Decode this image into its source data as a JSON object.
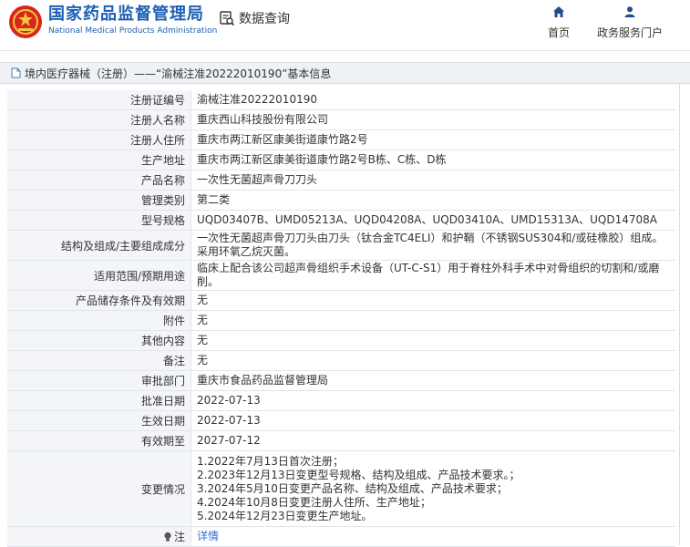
{
  "header": {
    "brand_cn": "国家药品监督管理局",
    "brand_en": "National Medical Products Administration",
    "data_query": "数据查询",
    "nav": [
      {
        "label": "首页",
        "icon": "home-icon"
      },
      {
        "label": "政务服务门户",
        "icon": "user-icon"
      }
    ],
    "colors": {
      "brand": "#1d5fb4",
      "accent": "#2a6fd6"
    }
  },
  "breadcrumb": {
    "text": "境内医疗器械（注册）——“渝械注准20222010190”基本信息"
  },
  "record": {
    "rows": [
      {
        "k": "注册证编号",
        "v": "渝械注准20222010190"
      },
      {
        "k": "注册人名称",
        "v": "重庆西山科技股份有限公司"
      },
      {
        "k": "注册人住所",
        "v": "重庆市两江新区康美街道康竹路2号"
      },
      {
        "k": "生产地址",
        "v": "重庆市两江新区康美街道康竹路2号B栋、C栋、D栋"
      },
      {
        "k": "产品名称",
        "v": "一次性无菌超声骨刀刀头"
      },
      {
        "k": "管理类别",
        "v": "第二类"
      },
      {
        "k": "型号规格",
        "v": "UQD03407B、UMD05213A、UQD04208A、UQD03410A、UMD15313A、UQD14708A"
      },
      {
        "k": "结构及组成/主要组成成分",
        "v": "一次性无菌超声骨刀刀头由刀头（钛合金TC4ELI）和护鞘（不锈钢SUS304和/或硅橡胶）组成。采用环氧乙烷灭菌。"
      },
      {
        "k": "适用范围/预期用途",
        "v": "临床上配合该公司超声骨组织手术设备（UT-C-S1）用于脊柱外科手术中对骨组织的切割和/或磨削。"
      },
      {
        "k": "产品储存条件及有效期",
        "v": "无"
      },
      {
        "k": "附件",
        "v": "无"
      },
      {
        "k": "其他内容",
        "v": "无"
      },
      {
        "k": "备注",
        "v": "无"
      },
      {
        "k": "审批部门",
        "v": "重庆市食品药品监督管理局"
      },
      {
        "k": "批准日期",
        "v": "2022-07-13"
      },
      {
        "k": "生效日期",
        "v": "2022-07-13"
      },
      {
        "k": "有效期至",
        "v": "2027-07-12"
      }
    ],
    "changes_label": "变更情况",
    "changes": [
      "1.2022年7月13日首次注册；",
      "2.2023年12月13日变更型号规格、结构及组成、产品技术要求。；",
      "3.2024年5月10日变更产品名称、结构及组成、产品技术要求；",
      "4.2024年10月8日变更注册人住所、生产地址；",
      "5.2024年12月23日变更生产地址。"
    ],
    "note_label": "注",
    "note_link": "详情"
  }
}
